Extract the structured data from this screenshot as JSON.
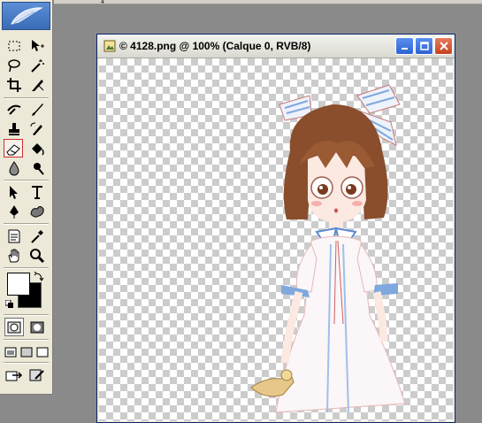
{
  "app": {
    "ruler_tick": "4"
  },
  "toolbox": {
    "tools": [
      {
        "name": "marquee-tool",
        "icon": "marquee-icon"
      },
      {
        "name": "move-tool",
        "icon": "move-icon"
      },
      {
        "name": "lasso-tool",
        "icon": "lasso-icon"
      },
      {
        "name": "magic-wand-tool",
        "icon": "magic-wand-icon"
      },
      {
        "name": "crop-tool",
        "icon": "crop-icon"
      },
      {
        "name": "slice-tool",
        "icon": "slice-icon"
      },
      {
        "name": "healing-brush-tool",
        "icon": "healing-brush-icon"
      },
      {
        "name": "brush-tool",
        "icon": "brush-icon"
      },
      {
        "name": "clone-stamp-tool",
        "icon": "clone-stamp-icon"
      },
      {
        "name": "history-brush-tool",
        "icon": "history-brush-icon"
      },
      {
        "name": "eraser-tool",
        "icon": "eraser-icon",
        "active": true
      },
      {
        "name": "paint-bucket-tool",
        "icon": "paint-bucket-icon"
      },
      {
        "name": "blur-tool",
        "icon": "blur-drop-icon"
      },
      {
        "name": "burn-tool",
        "icon": "burn-icon"
      },
      {
        "name": "path-selection-tool",
        "icon": "arrow-icon"
      },
      {
        "name": "type-tool",
        "icon": "type-icon"
      },
      {
        "name": "pen-tool",
        "icon": "pen-icon"
      },
      {
        "name": "custom-shape-tool",
        "icon": "shape-icon"
      },
      {
        "name": "notes-tool",
        "icon": "notes-icon"
      },
      {
        "name": "eyedropper-tool",
        "icon": "eyedropper-icon"
      },
      {
        "name": "hand-tool",
        "icon": "hand-icon"
      },
      {
        "name": "zoom-tool",
        "icon": "zoom-icon"
      }
    ],
    "foreground_color": "#ffffff",
    "background_color": "#000000"
  },
  "document": {
    "title": "© 4128.png @ 100% (Calque 0, RVB/8)",
    "accent": "#2d63d2",
    "close_color": "#c4431d"
  }
}
